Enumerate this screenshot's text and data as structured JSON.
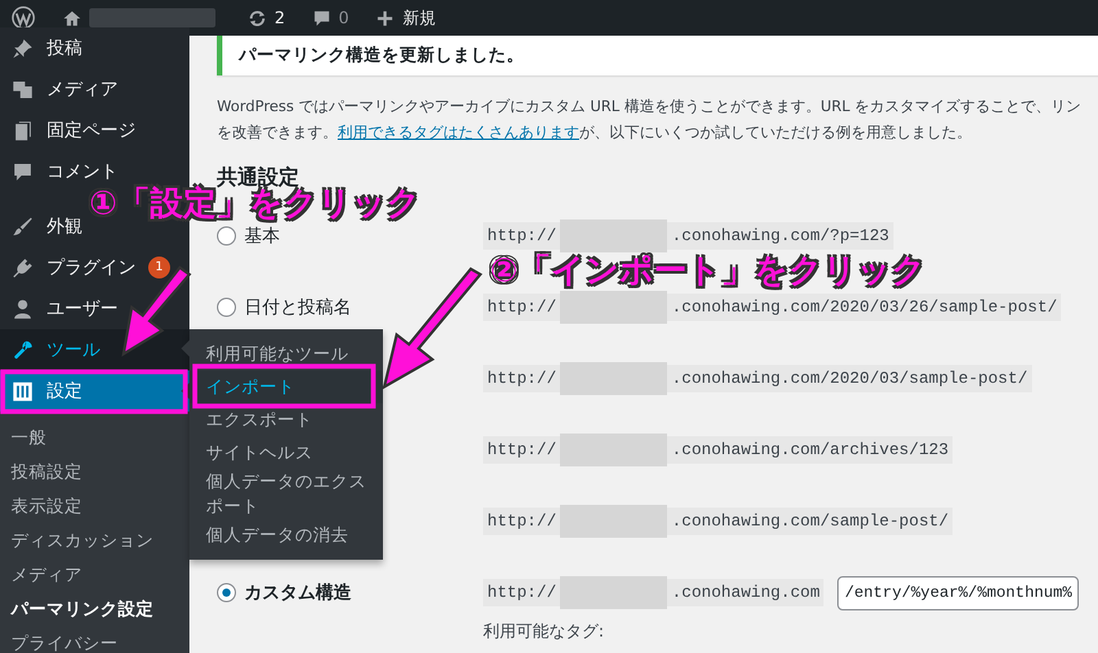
{
  "admin_bar": {
    "update_count": "2",
    "comment_count": "0",
    "new_label": "新規"
  },
  "menu_groups": [
    [
      {
        "label": "投稿",
        "hover": false,
        "selected": false
      },
      {
        "label": "メディア",
        "hover": false,
        "selected": false
      },
      {
        "label": "固定ページ",
        "hover": false,
        "selected": false
      },
      {
        "label": "コメント",
        "hover": false,
        "selected": false
      }
    ],
    [
      {
        "label": "外観",
        "hover": false,
        "selected": false
      },
      {
        "label": "プラグイン",
        "hover": false,
        "selected": false,
        "badge": "1"
      },
      {
        "label": "ユーザー",
        "hover": false,
        "selected": false
      },
      {
        "label": "ツール",
        "hover": true,
        "selected": false
      },
      {
        "label": "設定",
        "hover": false,
        "selected": true
      }
    ]
  ],
  "submenu": [
    {
      "label": "一般",
      "selected": false
    },
    {
      "label": "投稿設定",
      "selected": false
    },
    {
      "label": "表示設定",
      "selected": false
    },
    {
      "label": "ディスカッション",
      "selected": false
    },
    {
      "label": "メディア",
      "selected": false
    },
    {
      "label": "パーマリンク設定",
      "selected": true
    },
    {
      "label": "プライバシー",
      "selected": false
    }
  ],
  "flyout": [
    {
      "label": "利用可能なツール",
      "selected": false
    },
    {
      "label": "インポート",
      "selected": true
    },
    {
      "label": "エクスポート",
      "selected": false
    },
    {
      "label": "サイトヘルス",
      "selected": false
    },
    {
      "label": "個人データのエクスポート",
      "selected": false
    },
    {
      "label": "個人データの消去",
      "selected": false
    }
  ],
  "notice": "パーマリンク構造を更新しました。",
  "intro": {
    "line_1": "WordPress ではパーマリンクやアーカイブにカスタム URL 構造を使うことができます。URL をカスタマイズすることで、リン",
    "line_2_start": "を改善できます。",
    "link": "利用できるタグはたくさんあります",
    "line_2_end": "が、以下にいくつか試していただける例を用意しました。"
  },
  "heading": "共通設定",
  "options": [
    {
      "label": "基本",
      "selected": false,
      "url_prefix": "http://",
      "url_path": ".conohawing.com/?p=123"
    },
    {
      "label": "日付と投稿名",
      "selected": false,
      "url_prefix": "http://",
      "url_path": ".conohawing.com/2020/03/26/sample-post/"
    },
    {
      "url_prefix": "http://",
      "url_path": ".conohawing.com/2020/03/sample-post/"
    },
    {
      "url_prefix": "http://",
      "url_path": ".conohawing.com/archives/123"
    },
    {
      "url_prefix": "http://",
      "url_path": ".conohawing.com/sample-post/"
    },
    {
      "label": "カスタム構造",
      "selected": true,
      "url_prefix": "http://",
      "url_path": ".conohawing.com",
      "input_value": "/entry/%year%/%monthnum%"
    }
  ],
  "tags_label": "利用可能なタグ:",
  "annotations": [
    "①「設定」をクリック",
    "②「インポート」をクリック"
  ]
}
